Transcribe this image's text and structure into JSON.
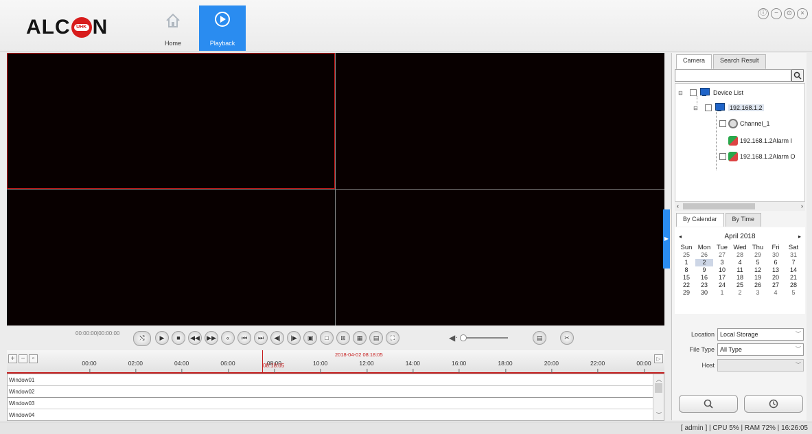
{
  "app": {
    "logo_text_left": "ALC",
    "logo_badge": "UHK",
    "logo_text_right": "N"
  },
  "nav": {
    "home_label": "Home",
    "playback_label": "Playback"
  },
  "window_controls": {
    "icons": [
      "info-icon",
      "minimize-icon",
      "restore-icon",
      "close-icon"
    ]
  },
  "accent_color": "#2a8cf0",
  "selected_pane_color": "#c01818",
  "right_panel": {
    "tabs": [
      "Camera",
      "Search Result"
    ],
    "active_tab": "Camera",
    "search_placeholder": "",
    "tree": {
      "root": "Device List",
      "device": "192.168.1.2",
      "channel": "Channel_1",
      "alarm_in": "192.168.1.2Alarm I",
      "alarm_out": "192.168.1.2Alarm O"
    },
    "mode_tabs": [
      "By Calendar",
      "By Time"
    ],
    "calendar": {
      "month_label": "April 2018",
      "prev": "◂",
      "next": "▸",
      "weekdays": [
        "Sun",
        "Mon",
        "Tue",
        "Wed",
        "Thu",
        "Fri",
        "Sat"
      ],
      "weeks": [
        [
          "25",
          "26",
          "27",
          "28",
          "29",
          "30",
          "31"
        ],
        [
          "1",
          "2",
          "3",
          "4",
          "5",
          "6",
          "7"
        ],
        [
          "8",
          "9",
          "10",
          "11",
          "12",
          "13",
          "14"
        ],
        [
          "15",
          "16",
          "17",
          "18",
          "19",
          "20",
          "21"
        ],
        [
          "22",
          "23",
          "24",
          "25",
          "26",
          "27",
          "28"
        ],
        [
          "29",
          "30",
          "1",
          "2",
          "3",
          "4",
          "5"
        ]
      ],
      "selected_day": "2"
    },
    "location_label": "Location",
    "location_value": "Local Storage",
    "file_type_label": "File Type",
    "file_type_value": "All Type",
    "host_label": "Host",
    "host_value": ""
  },
  "controls": {
    "time_display": "00:00:00|00:00:00",
    "volume_level": 0.05
  },
  "timeline": {
    "ticks": [
      "00:00",
      "02:00",
      "04:00",
      "06:00",
      "08:00",
      "10:00",
      "12:00",
      "14:00",
      "16:00",
      "18:00",
      "20:00",
      "22:00",
      "00:00"
    ],
    "current_datetime": "2018-04-02 08:18:05",
    "current_time": "08:18:05"
  },
  "windows": [
    "Window01",
    "Window02",
    "Window03",
    "Window04"
  ],
  "status": {
    "text": "[ admin ] | CPU  5% | RAM  72% | 16:26:05"
  }
}
